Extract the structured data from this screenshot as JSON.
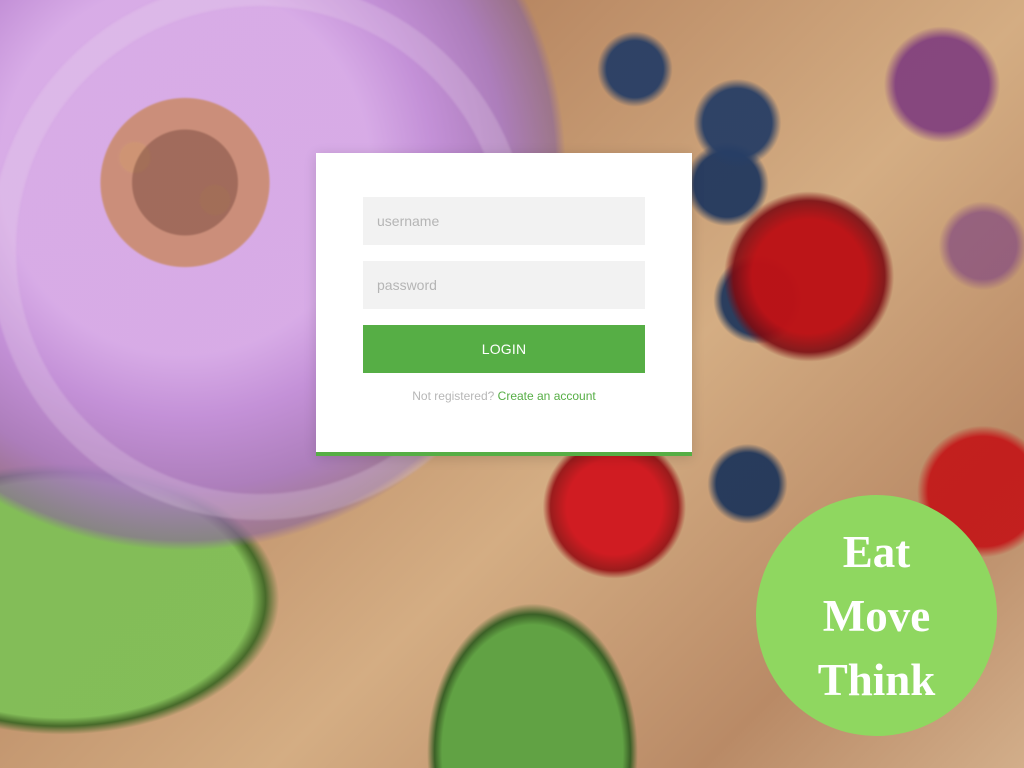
{
  "background": {
    "scene": "smoothie-berries-avocado"
  },
  "login": {
    "username_placeholder": "username",
    "password_placeholder": "password",
    "button_label": "LOGIN",
    "register_prompt": "Not registered?",
    "register_link": "Create an account"
  },
  "badge": {
    "line1": "Eat",
    "line2": "Move",
    "line3": "Think"
  },
  "colors": {
    "accent_green": "#56ae45",
    "badge_green": "#8fd760",
    "card_white": "#ffffff",
    "field_gray": "#f2f2f2"
  }
}
